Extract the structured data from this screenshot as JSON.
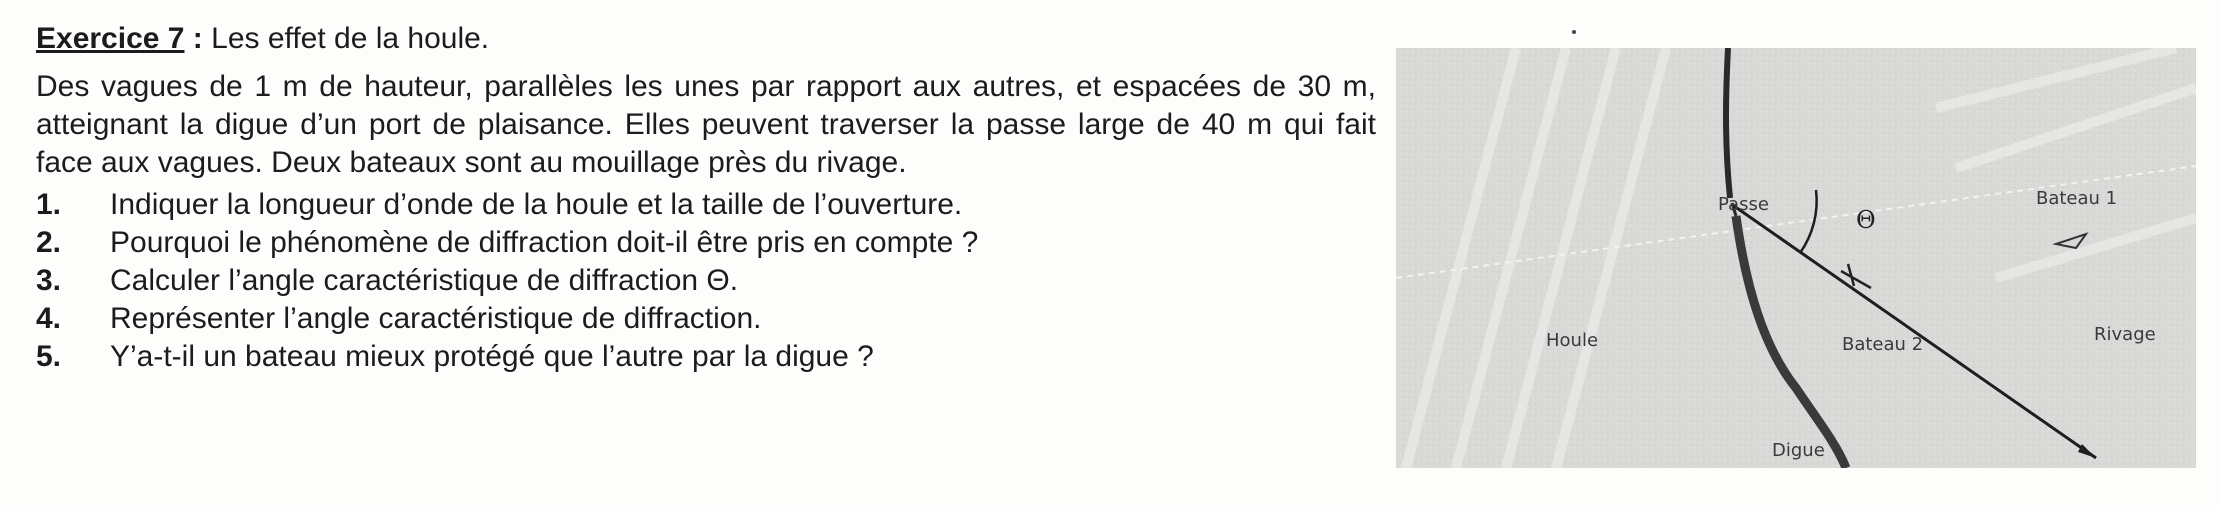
{
  "exercise": {
    "label": "Exercice 7",
    "colon": " :",
    "subtitle": " Les effet de la houle.",
    "statement": "Des vagues de 1 m de hauteur, parallèles les unes par rapport aux autres, et espacées de 30 m, atteignant la digue d’un port de plaisance. Elles peuvent traverser la passe large de 40 m qui fait face aux vagues. Deux bateaux sont au mouillage près du rivage.",
    "questions": [
      {
        "number": "1.",
        "text": "Indiquer la longueur d’onde de la houle et la taille de l’ouverture."
      },
      {
        "number": "2.",
        "text": "Pourquoi le phénomène de diffraction doit-il être pris en compte ?"
      },
      {
        "number": "3.",
        "text": "Calculer l’angle caractéristique de diffraction Θ."
      },
      {
        "number": "4.",
        "text": "Représenter l’angle caractéristique de diffraction."
      },
      {
        "number": "5.",
        "text": "Y’a-t-il un bateau mieux protégé que l’autre par la digue ?"
      }
    ]
  },
  "figure": {
    "labels": {
      "passe": "Passe",
      "bateau1": "Bateau 1",
      "houle": "Houle",
      "bateau2": "Bateau 2",
      "rivage": "Rivage",
      "digue": "Digue",
      "theta": "Θ"
    },
    "colors": {
      "background": "#d9d9d7",
      "lines": "#2a2a2a",
      "waves": "#eeeeec"
    }
  }
}
